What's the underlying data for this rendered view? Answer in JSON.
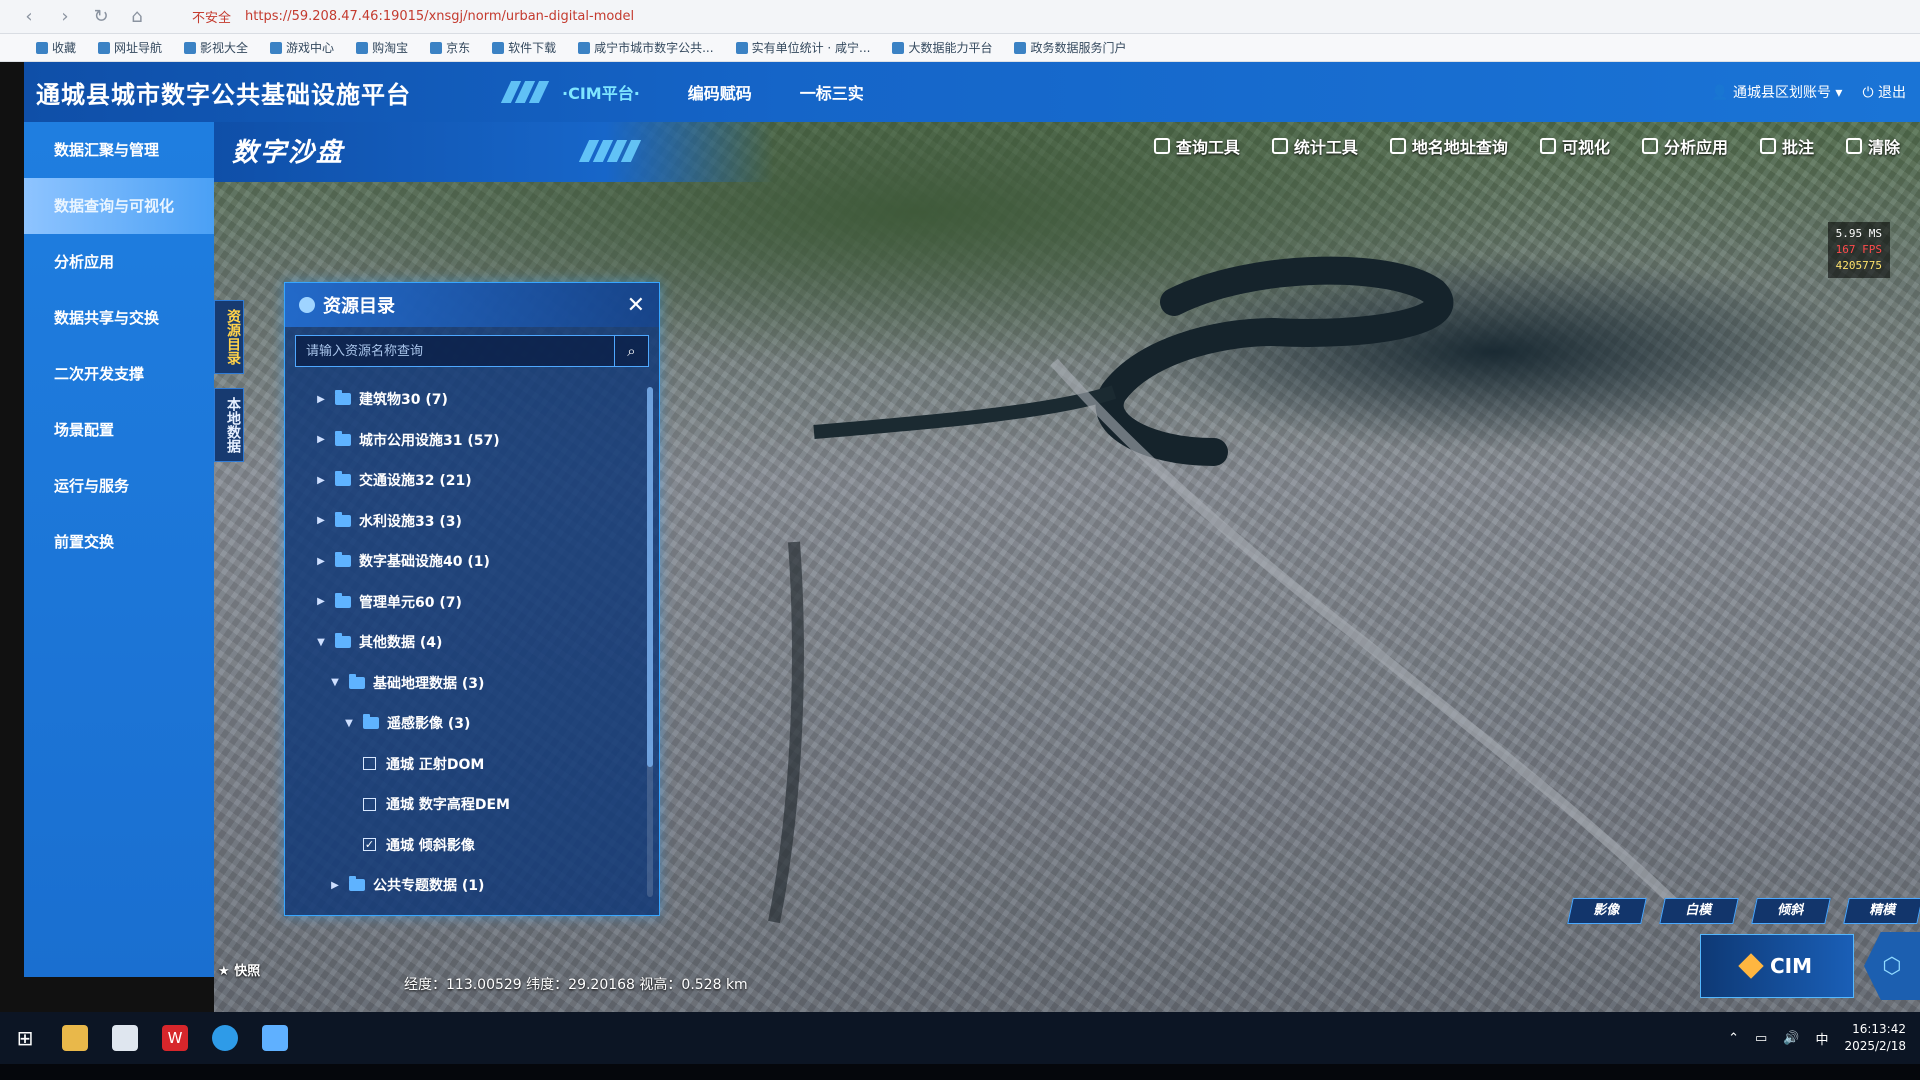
{
  "browser": {
    "security_label": "不安全",
    "url": "https://59.208.47.46:19015/xnsgj/norm/urban-digital-model",
    "bookmarks": [
      "收藏",
      "网址导航",
      "影视大全",
      "游戏中心",
      "购淘宝",
      "京东",
      "软件下载",
      "咸宁市城市数字公共...",
      "实有单位统计 · 咸宁...",
      "大数据能力平台",
      "政务数据服务门户"
    ]
  },
  "header": {
    "title": "通城县城市数字公共基础设施平台",
    "tabs": [
      {
        "label": "·CIM平台·",
        "active": true
      },
      {
        "label": "编码赋码",
        "active": false
      },
      {
        "label": "一标三实",
        "active": false
      }
    ],
    "account": "通城县区划账号",
    "logout": "退出"
  },
  "nav": {
    "items": [
      {
        "label": "数据汇聚与管理",
        "active": false
      },
      {
        "label": "数据查询与可视化",
        "active": true
      },
      {
        "label": "分析应用",
        "active": false
      },
      {
        "label": "数据共享与交换",
        "active": false
      },
      {
        "label": "二次开发支撑",
        "active": false
      },
      {
        "label": "场景配置",
        "active": false
      },
      {
        "label": "运行与服务",
        "active": false
      },
      {
        "label": "前置交换",
        "active": false
      }
    ]
  },
  "map": {
    "title": "数字沙盘",
    "tools": [
      {
        "label": "查询工具",
        "icon": "database-icon"
      },
      {
        "label": "统计工具",
        "icon": "stack-icon"
      },
      {
        "label": "地名地址查询",
        "icon": "search-icon"
      },
      {
        "label": "可视化",
        "icon": "briefcase-icon"
      },
      {
        "label": "分析应用",
        "icon": "compass-icon"
      },
      {
        "label": "批注",
        "icon": "flag-icon"
      },
      {
        "label": "清除",
        "icon": "trash-icon"
      }
    ],
    "stats": {
      "ms": "5.95 MS",
      "fps": "167 FPS",
      "count": "4205775"
    },
    "side_tabs": [
      "资源目录",
      "本地数据"
    ],
    "snapshot": "快照",
    "coords": "经度：113.00529  纬度：29.20168  视高：0.528 km",
    "layer_buttons": [
      "影像",
      "白模",
      "倾斜",
      "精模"
    ],
    "cim_label": "CIM"
  },
  "resource_panel": {
    "title": "资源目录",
    "search_placeholder": "请输入资源名称查询",
    "tree": [
      {
        "label": "建筑物30 (7)",
        "level": 0,
        "type": "folder",
        "expanded": false
      },
      {
        "label": "城市公用设施31 (57)",
        "level": 0,
        "type": "folder",
        "expanded": false
      },
      {
        "label": "交通设施32 (21)",
        "level": 0,
        "type": "folder",
        "expanded": false
      },
      {
        "label": "水利设施33 (3)",
        "level": 0,
        "type": "folder",
        "expanded": false
      },
      {
        "label": "数字基础设施40 (1)",
        "level": 0,
        "type": "folder",
        "expanded": false
      },
      {
        "label": "管理单元60 (7)",
        "level": 0,
        "type": "folder",
        "expanded": false
      },
      {
        "label": "其他数据 (4)",
        "level": 0,
        "type": "folder",
        "expanded": true
      },
      {
        "label": "基础地理数据 (3)",
        "level": 1,
        "type": "folder",
        "expanded": true
      },
      {
        "label": "遥感影像 (3)",
        "level": 2,
        "type": "folder",
        "expanded": true
      },
      {
        "label": "通城 正射DOM",
        "level": 3,
        "type": "checkbox",
        "checked": false
      },
      {
        "label": "通城 数字高程DEM",
        "level": 3,
        "type": "checkbox",
        "checked": false
      },
      {
        "label": "通城 倾斜影像",
        "level": 3,
        "type": "checkbox",
        "checked": true
      },
      {
        "label": "公共专题数据 (1)",
        "level": 1,
        "type": "folder",
        "expanded": false
      }
    ]
  },
  "taskbar": {
    "time": "16:13:42",
    "date": "2025/2/18",
    "ime": "中"
  }
}
